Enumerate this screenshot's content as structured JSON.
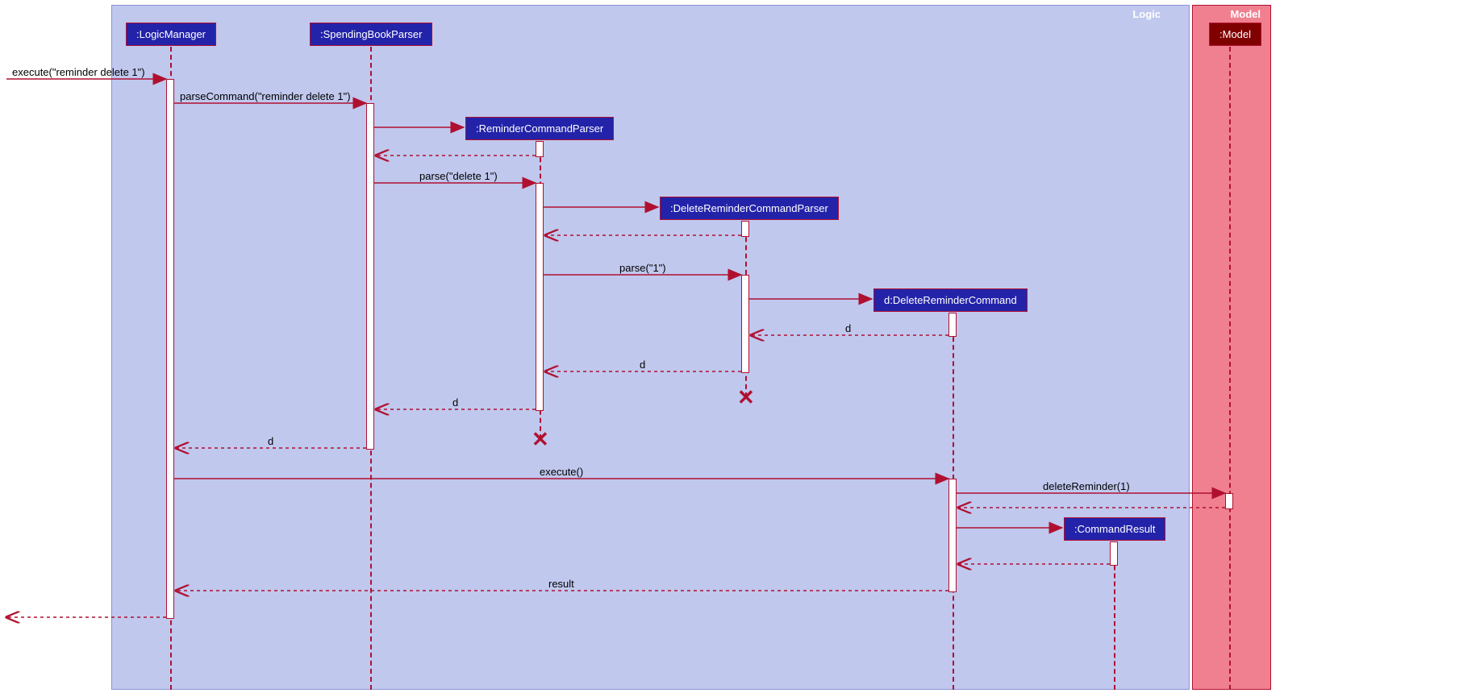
{
  "frames": {
    "logic": {
      "label": "Logic"
    },
    "model": {
      "label": "Model"
    }
  },
  "participants": {
    "logicManager": ":LogicManager",
    "spendingBookParser": ":SpendingBookParser",
    "reminderCommandParser": ":ReminderCommandParser",
    "deleteReminderCommandParser": ":DeleteReminderCommandParser",
    "deleteReminderCommand": "d:DeleteReminderCommand",
    "commandResult": ":CommandResult",
    "model": ":Model"
  },
  "messages": {
    "m1": "execute(\"reminder delete 1\")",
    "m2": "parseCommand(\"reminder delete 1\")",
    "m3": "parse(\"delete 1\")",
    "m4": "parse(\"1\")",
    "m5": "d",
    "m6": "d",
    "m7": "d",
    "m8": "d",
    "m9": "execute()",
    "m10": "deleteReminder(1)",
    "m11": "result"
  }
}
